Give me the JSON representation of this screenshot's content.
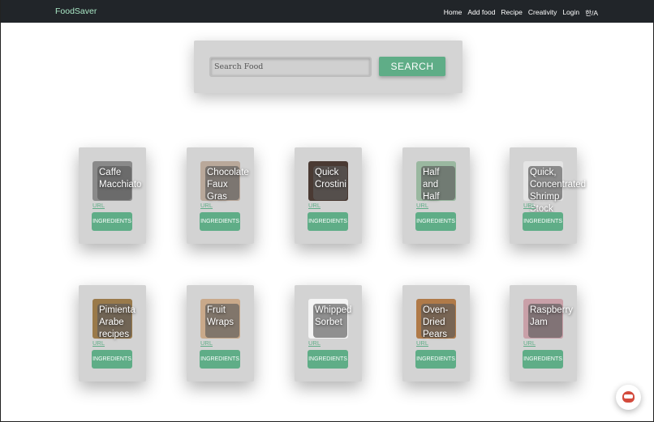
{
  "nav": {
    "brand": "FoodSaver",
    "links": [
      "Home",
      "Add food",
      "Recipe",
      "Creativity",
      "Login",
      "한/A"
    ]
  },
  "search": {
    "placeholder": "Search Food",
    "button_label": "SEARCH"
  },
  "recipes": [
    {
      "title": [
        "Caffe",
        "Macchiato"
      ],
      "url_label": "URL",
      "ingredients_label": "INGREDIENTS",
      "thumb_color": "#8a8a8a"
    },
    {
      "title": [
        "Chocolate",
        "Faux",
        "Gras"
      ],
      "url_label": "URL",
      "ingredients_label": "INGREDIENTS",
      "thumb_color": "#b9a89a"
    },
    {
      "title": [
        "Quick",
        "Crostini"
      ],
      "url_label": "URL",
      "ingredients_label": "INGREDIENTS",
      "thumb_color": "#4a3a33"
    },
    {
      "title": [
        "Half",
        "and",
        "Half"
      ],
      "url_label": "URL",
      "ingredients_label": "INGREDIENTS",
      "thumb_color": "#9ab8a0"
    },
    {
      "title": [
        "Quick,",
        "Concentrated",
        "Shrimp",
        "Stock"
      ],
      "url_label": "URL",
      "ingredients_label": "INGREDIENTS",
      "thumb_color": "#e4e4e4"
    },
    {
      "title": [
        "Pimienta",
        "Arabe",
        "recipes"
      ],
      "url_label": "URL",
      "ingredients_label": "INGREDIENTS",
      "thumb_color": "#9a7a4a"
    },
    {
      "title": [
        "Fruit",
        "Wraps"
      ],
      "url_label": "URL",
      "ingredients_label": "INGREDIENTS",
      "thumb_color": "#c9a98a"
    },
    {
      "title": [
        "Whipped",
        "Sorbet"
      ],
      "url_label": "URL",
      "ingredients_label": "INGREDIENTS",
      "thumb_color": "#f4f4f4"
    },
    {
      "title": [
        "Oven-",
        "Dried",
        "Pears"
      ],
      "url_label": "URL",
      "ingredients_label": "INGREDIENTS",
      "thumb_color": "#b07a48"
    },
    {
      "title": [
        "Raspberry",
        "Jam"
      ],
      "url_label": "URL",
      "ingredients_label": "INGREDIENTS",
      "thumb_color": "#c9a0a8"
    }
  ],
  "icons": {
    "chat_widget": "robot-chat-icon"
  },
  "colors": {
    "accent": "#5fad87",
    "navbar": "#212529",
    "brand": "#a8e6c4"
  }
}
